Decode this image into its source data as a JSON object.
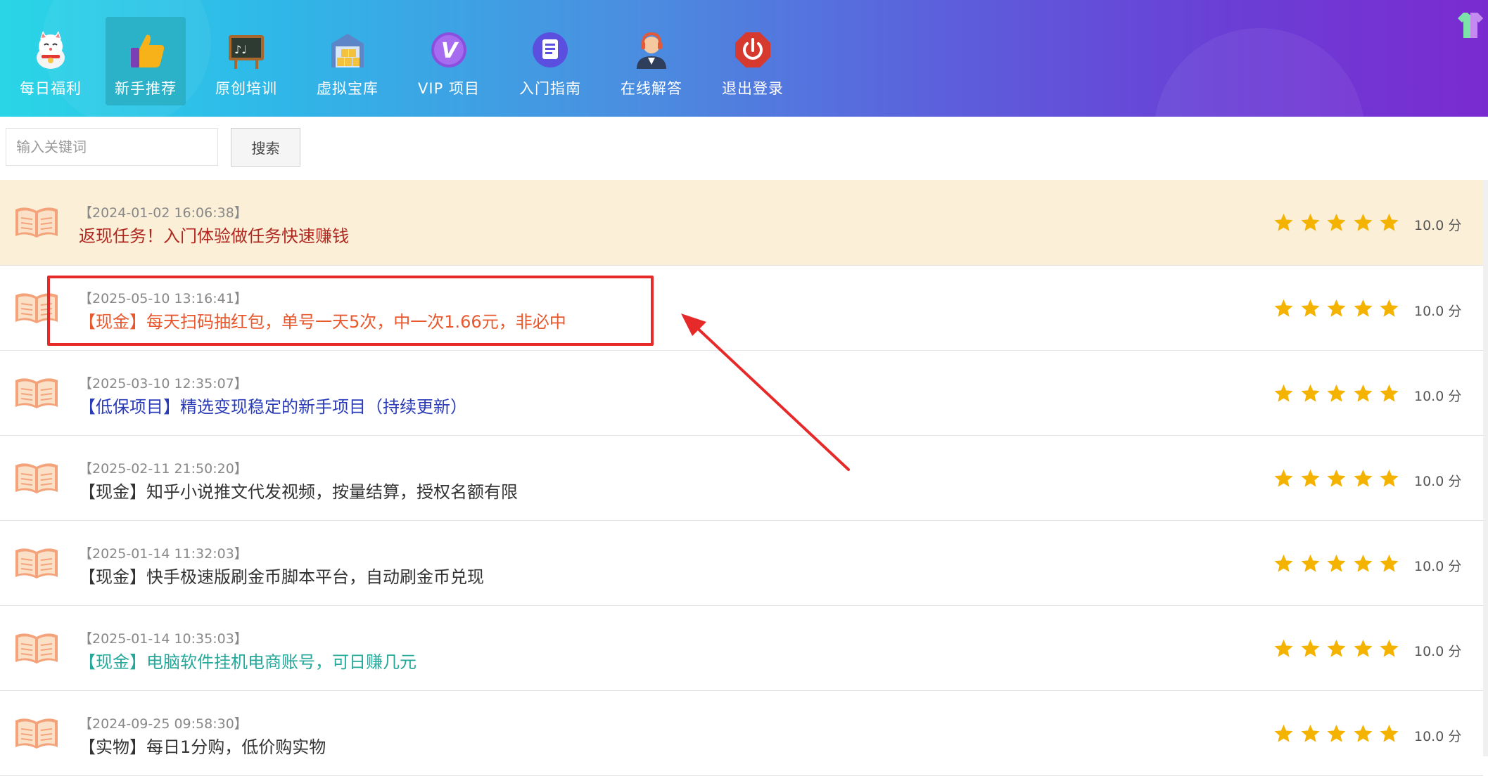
{
  "nav": {
    "items": [
      {
        "label": "每日福利",
        "icon": "lucky-cat-icon",
        "active": false
      },
      {
        "label": "新手推荐",
        "icon": "thumbs-up-icon",
        "active": true
      },
      {
        "label": "原创培训",
        "icon": "blackboard-icon",
        "active": false
      },
      {
        "label": "虚拟宝库",
        "icon": "warehouse-icon",
        "active": false
      },
      {
        "label": "VIP 项目",
        "icon": "vip-icon",
        "active": false
      },
      {
        "label": "入门指南",
        "icon": "guide-icon",
        "active": false
      },
      {
        "label": "在线解答",
        "icon": "support-agent-icon",
        "active": false
      },
      {
        "label": "退出登录",
        "icon": "power-icon",
        "active": false
      }
    ]
  },
  "search": {
    "placeholder": "输入关键词",
    "value": "",
    "button_label": "搜索"
  },
  "list": {
    "rows": [
      {
        "date": "【2024-01-02 16:06:38】",
        "title": "返现任务！入门体验做任务快速赚钱",
        "score": "10.0 分",
        "stars": 5
      },
      {
        "date": "【2025-05-10 13:16:41】",
        "title": "【现金】每天扫码抽红包，单号一天5次，中一次1.66元，非必中",
        "score": "10.0 分",
        "stars": 5
      },
      {
        "date": "【2025-03-10 12:35:07】",
        "title": "【低保项目】精选变现稳定的新手项目（持续更新）",
        "score": "10.0 分",
        "stars": 5
      },
      {
        "date": "【2025-02-11 21:50:20】",
        "title": "【现金】知乎小说推文代发视频，按量结算，授权名额有限",
        "score": "10.0 分",
        "stars": 5
      },
      {
        "date": "【2025-01-14 11:32:03】",
        "title": "【现金】快手极速版刷金币脚本平台，自动刷金币兑现",
        "score": "10.0 分",
        "stars": 5
      },
      {
        "date": "【2025-01-14 10:35:03】",
        "title": "【现金】电脑软件挂机电商账号，可日赚几元",
        "score": "10.0 分",
        "stars": 5
      },
      {
        "date": "【2024-09-25 09:58:30】",
        "title": "【实物】每日1分购，低价购实物",
        "score": "10.0 分",
        "stars": 5
      }
    ]
  },
  "colors": {
    "row_title_colors": [
      "#b0271f",
      "#e8582c",
      "#2a3bb8",
      "#333333",
      "#333333",
      "#23a89a",
      "#333333"
    ],
    "star": "#f5b301",
    "pinned_bg": "#fbefd8",
    "annotation": "#e62a2a"
  }
}
